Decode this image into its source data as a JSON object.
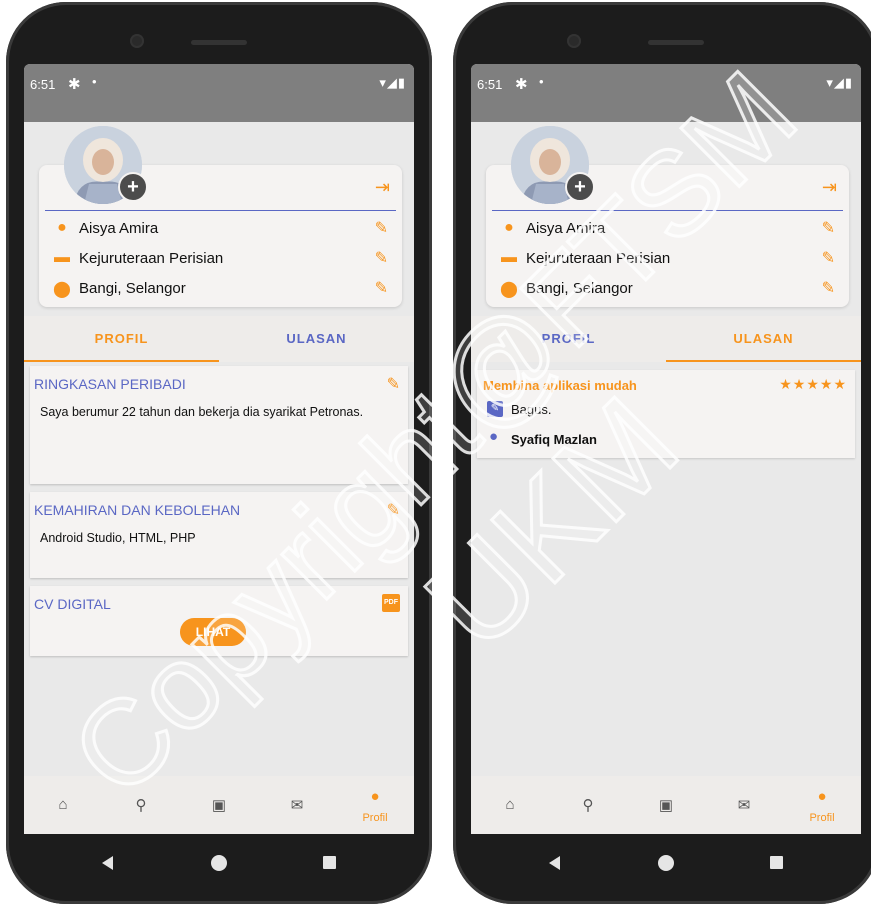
{
  "status": {
    "time": "6:51"
  },
  "profile": {
    "name": "Aisya Amira",
    "department": "Kejuruteraan Perisian",
    "location": "Bangi, Selangor"
  },
  "tabs": [
    "PROFIL",
    "ULASAN"
  ],
  "sections": {
    "summary_title": "RINGKASAN PERIBADI",
    "summary_text": "Saya berumur 22 tahun dan bekerja dia syarikat Petronas.",
    "skills_title": "KEMAHIRAN DAN KEBOLEHAN",
    "skills_text": "Android Studio, HTML, PHP",
    "cv_title": "CV DIGITAL",
    "cv_button": "LIHAT",
    "pdf_label": "PDF"
  },
  "review": {
    "title": "Membina aplikasi mudah",
    "stars": "★★★★★",
    "rating": 5,
    "comment": "Bagus.",
    "reviewer": "Syafiq Mazlan"
  },
  "nav": {
    "active_label": "Profil"
  },
  "watermark": {
    "line1": "Copyright@FTSM",
    "line2": "UKM"
  },
  "icons": [
    "gear-icon",
    "wifi-icon",
    "signal-icon",
    "battery-icon",
    "plus-icon",
    "logout-icon",
    "person-icon",
    "briefcase-icon",
    "location-pin-icon",
    "pencil-icon",
    "pdf-icon",
    "home-icon",
    "search-icon",
    "jobs-icon",
    "mail-icon",
    "profile-icon",
    "comment-icon",
    "star-icon"
  ],
  "colors": {
    "accent": "#f7941d",
    "primary": "#5a67c4",
    "statusbar": "#7f7f7f"
  }
}
